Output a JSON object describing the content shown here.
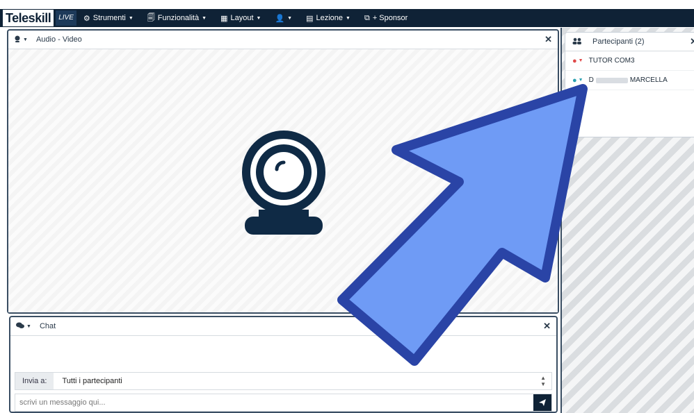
{
  "topbar": {
    "brand": "Teleskill",
    "live": "LIVE",
    "menu": [
      {
        "icon": "⚙",
        "label": "Strumenti",
        "dropdown": true
      },
      {
        "icon": "🗐",
        "label": "Funzionalità",
        "dropdown": true
      },
      {
        "icon": "▦",
        "label": "Layout",
        "dropdown": true
      },
      {
        "icon": "👤",
        "label": "",
        "dropdown": true
      },
      {
        "icon": "▤",
        "label": "Lezione",
        "dropdown": true
      },
      {
        "icon": "⧉",
        "label": "+ Sponsor",
        "dropdown": false
      }
    ]
  },
  "av_panel": {
    "title": "Audio - Video",
    "close": "✕",
    "icon": "webcam-icon"
  },
  "chat": {
    "title": "Chat",
    "close": "✕",
    "send_to_label": "Invia a:",
    "send_to_value": "Tutti i partecipanti",
    "message_placeholder": "scrivi un messaggio qui...",
    "send_icon": "paper-plane-icon"
  },
  "participants": {
    "title": "Partecipanti (2)",
    "close": "✕",
    "items": [
      {
        "name": "TUTOR COM3",
        "avatar_color": "#e04a4a"
      },
      {
        "name_prefix": "D",
        "name": "MARCELLA",
        "avatar_color": "#2aa0b0"
      }
    ]
  },
  "colors": {
    "navbar": "#0f2236",
    "arrow_fill": "#6f9bf5",
    "arrow_stroke": "#2a44a6"
  }
}
